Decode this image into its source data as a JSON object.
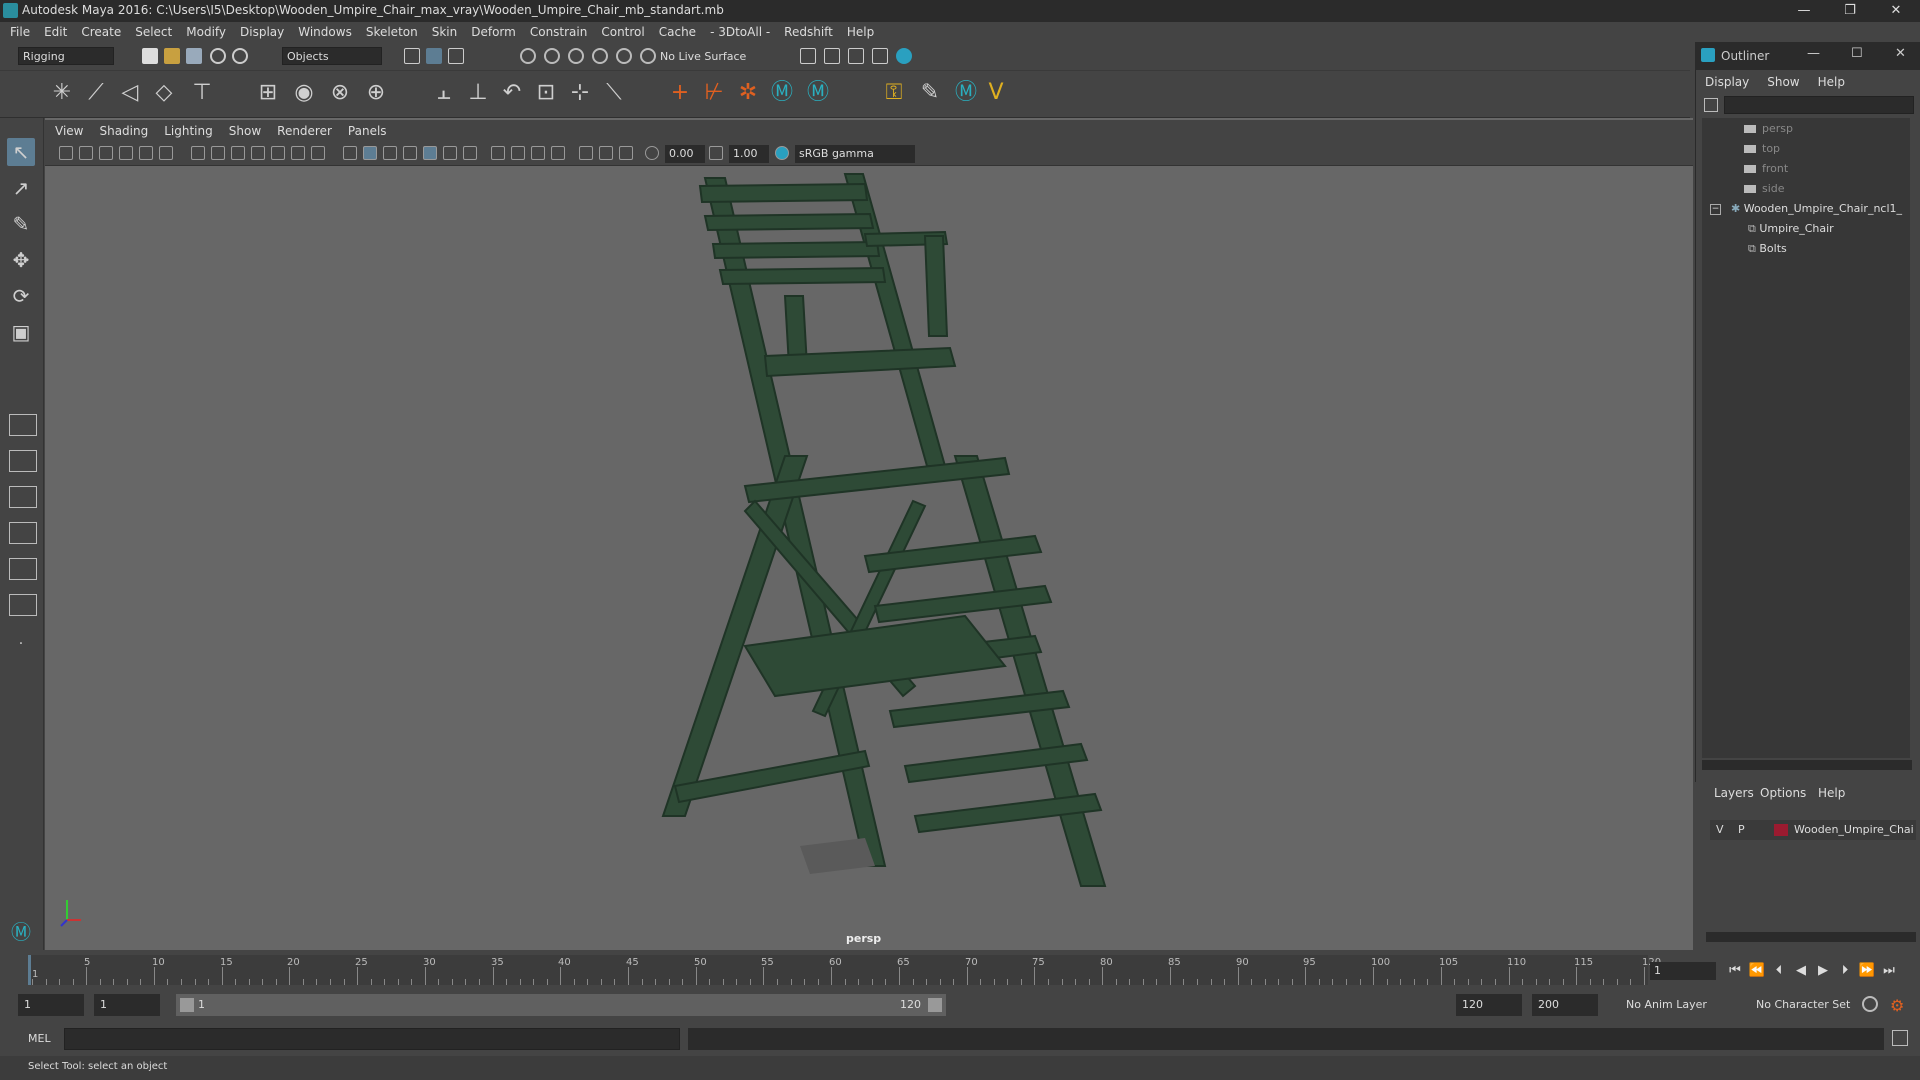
{
  "window": {
    "title": "Autodesk Maya 2016: C:\\Users\\I5\\Desktop\\Wooden_Umpire_Chair_max_vray\\Wooden_Umpire_Chair_mb_standart.mb",
    "minimize": "—",
    "maximize": "❐",
    "close": "✕"
  },
  "menu": [
    "File",
    "Edit",
    "Create",
    "Select",
    "Modify",
    "Display",
    "Windows",
    "Skeleton",
    "Skin",
    "Deform",
    "Constrain",
    "Control",
    "Cache",
    "- 3DtoAll -",
    "Redshift",
    "Help"
  ],
  "statusline": {
    "mode": "Rigging",
    "selection_mode": "Objects",
    "live_surface": "No Live Surface"
  },
  "viewport": {
    "menu": [
      "View",
      "Shading",
      "Lighting",
      "Show",
      "Renderer",
      "Panels"
    ],
    "exposure": "0.00",
    "gamma": "1.00",
    "color_space": "sRGB gamma",
    "camera_label": "persp"
  },
  "outliner": {
    "title": "Outliner",
    "menu": [
      "Display",
      "Show",
      "Help"
    ],
    "cameras": [
      "persp",
      "top",
      "front",
      "side"
    ],
    "group": "Wooden_Umpire_Chair_ncl1_",
    "children": [
      "Umpire_Chair",
      "Bolts"
    ]
  },
  "layers": {
    "menu": [
      "Layers",
      "Options",
      "Help"
    ],
    "row": {
      "v": "V",
      "p": "P",
      "name": "Wooden_Umpire_Chai",
      "color": "#9b1b30"
    }
  },
  "timeline": {
    "ticks": [
      "5",
      "10",
      "15",
      "20",
      "25",
      "30",
      "35",
      "40",
      "45",
      "50",
      "55",
      "60",
      "65",
      "70",
      "75",
      "80",
      "85",
      "90",
      "95",
      "100",
      "105",
      "110",
      "115",
      "120"
    ],
    "current_frame": "1",
    "current_field": "1"
  },
  "range": {
    "start": "1",
    "playback_start": "1",
    "slider_start": "1",
    "slider_end": "120",
    "playback_end": "120",
    "end": "200",
    "anim_layer": "No Anim Layer",
    "character_set": "No Character Set"
  },
  "cmd": {
    "label": "MEL"
  },
  "help": {
    "text": "Select Tool: select an object"
  },
  "colors": {
    "accent": "#5d7d93",
    "chair": "#2e4a36"
  }
}
